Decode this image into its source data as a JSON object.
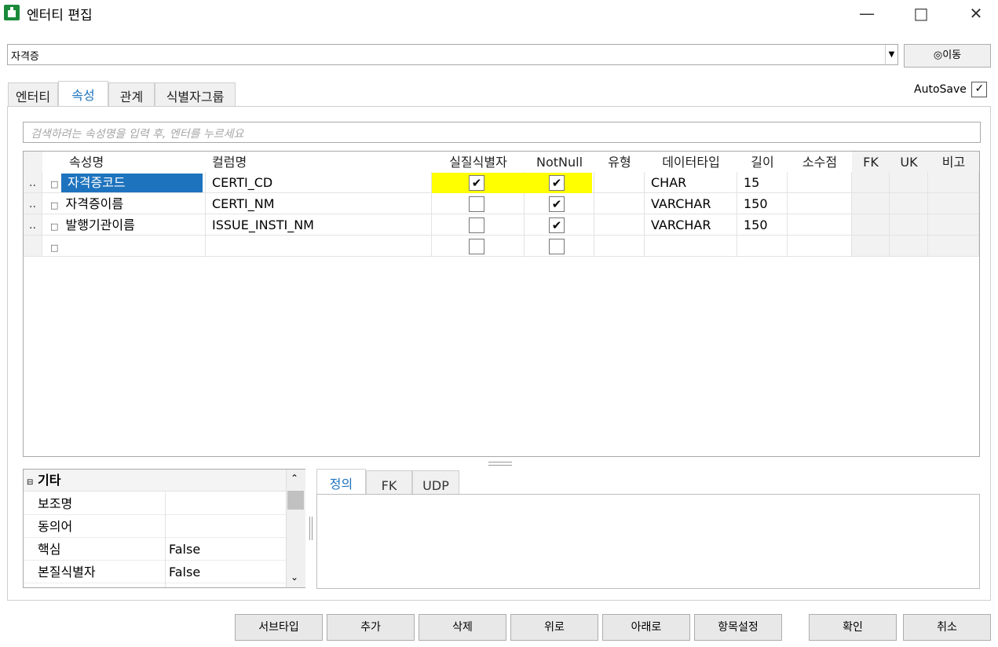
{
  "window": {
    "title": "엔터티 편집"
  },
  "entity_select": {
    "value": "자격증",
    "move_label": "이동"
  },
  "tabs": [
    {
      "label": "엔터티"
    },
    {
      "label": "속성"
    },
    {
      "label": "관계"
    },
    {
      "label": "식별자그룹"
    }
  ],
  "autosave": {
    "label": "AutoSave",
    "checked": true
  },
  "search": {
    "placeholder": "검색하려는 속성명을 입력 후, 엔터를 누르세요"
  },
  "grid": {
    "headers": [
      "속성명",
      "컬럼명",
      "실질식별자",
      "NotNull",
      "유형",
      "데이터타입",
      "길이",
      "소수점",
      "FK",
      "UK",
      "비고"
    ],
    "rows": [
      {
        "indicator": "..",
        "name": "자격증코드",
        "column": "CERTI_CD",
        "pk": true,
        "notnull": true,
        "type": "",
        "datatype": "CHAR",
        "length": "15",
        "scale": ""
      },
      {
        "indicator": "..",
        "name": "자격증이름",
        "column": "CERTI_NM",
        "pk": false,
        "notnull": true,
        "type": "",
        "datatype": "VARCHAR",
        "length": "150",
        "scale": ""
      },
      {
        "indicator": "..",
        "name": "발행기관이름",
        "column": "ISSUE_INSTI_NM",
        "pk": false,
        "notnull": true,
        "type": "",
        "datatype": "VARCHAR",
        "length": "150",
        "scale": ""
      },
      {
        "indicator": "",
        "name": "",
        "column": "",
        "pk": false,
        "notnull": false,
        "type": "",
        "datatype": "",
        "length": "",
        "scale": ""
      }
    ]
  },
  "properties": {
    "group": "기타",
    "items": [
      {
        "label": "보조명",
        "value": ""
      },
      {
        "label": "동의어",
        "value": ""
      },
      {
        "label": "핵심",
        "value": "False"
      },
      {
        "label": "본질식별자",
        "value": "False"
      }
    ]
  },
  "detail_tabs": [
    {
      "label": "정의"
    },
    {
      "label": "FK"
    },
    {
      "label": "UDP"
    }
  ],
  "buttons": {
    "subtype": "서브타입",
    "add": "추가",
    "delete": "삭제",
    "up": "위로",
    "down": "아래로",
    "item_settings": "항목설정",
    "ok": "확인",
    "cancel": "취소"
  },
  "colors": {
    "accent": "#1e73be",
    "highlight": "#ffff00"
  }
}
